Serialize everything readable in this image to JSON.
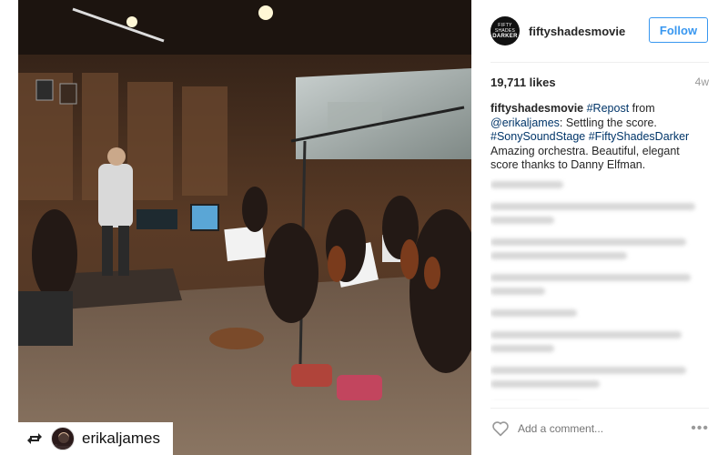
{
  "post": {
    "username": "fiftyshadesmovie",
    "follow_label": "Follow",
    "likes": "19,711 likes",
    "time_ago": "4w",
    "caption": {
      "author": "fiftyshadesmovie",
      "tag_repost": "#Repost",
      "from_text": "from",
      "mention": "@erikaljames",
      "text1": ": Settling the score.",
      "tags": "#SonySoundStage #FiftyShadesDarker",
      "text2": "Amazing orchestra. Beautiful, elegant score thanks to Danny Elfman."
    },
    "comment_placeholder": "Add a comment...",
    "more_label": "•••"
  },
  "repost": {
    "username": "erikaljames"
  },
  "avatar": {
    "line1": "FIFTY SHADES",
    "line2": "DARKER"
  },
  "icons": {
    "repost": "repost-icon",
    "heart": "heart-icon",
    "more": "more-icon"
  },
  "colors": {
    "follow_blue": "#3897f0",
    "link_navy": "#003569",
    "muted_gray": "#999999"
  }
}
